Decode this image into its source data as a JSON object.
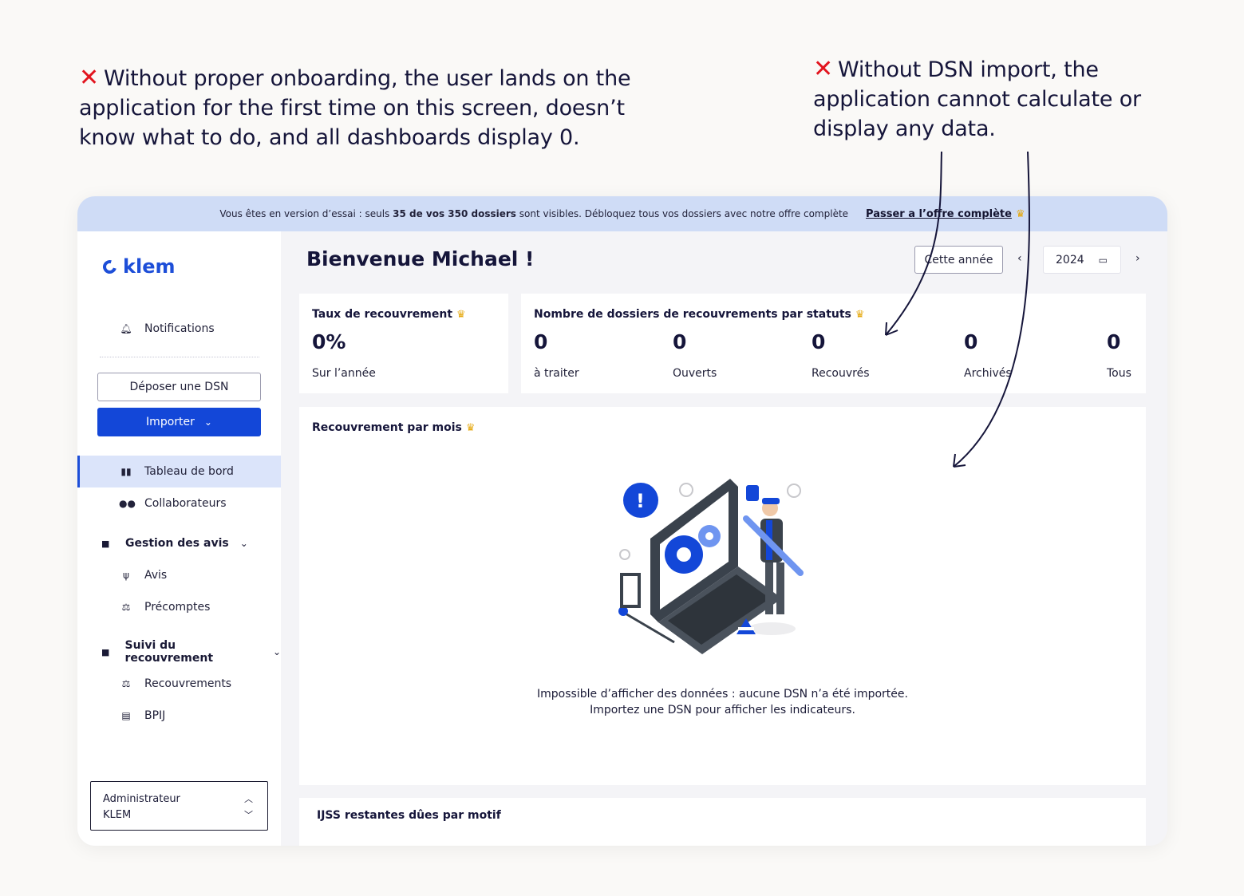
{
  "annotations": {
    "left": "Without proper onboarding, the user lands on the application for the first time on this screen, doesn’t know what to do, and all dashboards display 0.",
    "right": "Without DSN import, the application cannot calculate or display any data."
  },
  "banner": {
    "text_prefix": "Vous êtes en version d’essai : seuls ",
    "text_bold": "35 de vos 350 dossiers",
    "text_suffix": " sont visibles. Débloquez tous vos dossiers avec notre offre complète",
    "cta": "Passer a l’offre complète"
  },
  "sidebar": {
    "logo": "klem",
    "notifications": "Notifications",
    "deposit_button": "Déposer une DSN",
    "import_button": "Importer",
    "items": [
      {
        "label": "Tableau de bord",
        "icon": "bar-chart-icon"
      },
      {
        "label": "Collaborateurs",
        "icon": "users-icon"
      }
    ],
    "group_avis": {
      "label": "Gestion des avis",
      "items": [
        {
          "label": "Avis",
          "icon": "stethoscope-icon"
        },
        {
          "label": "Précomptes",
          "icon": "scale-icon"
        }
      ]
    },
    "group_suivi": {
      "label": "Suivi du recouvrement",
      "items": [
        {
          "label": "Recouvrements",
          "icon": "scale-icon"
        },
        {
          "label": "BPIJ",
          "icon": "document-icon"
        }
      ]
    },
    "role": {
      "title": "Administrateur",
      "org": "KLEM"
    }
  },
  "header": {
    "welcome": "Bienvenue Michael !",
    "period_button": "Cette année",
    "year": "2024"
  },
  "cards": {
    "taux": {
      "title": "Taux de recouvrement",
      "value": "0%",
      "caption": "Sur l’année"
    },
    "statuts": {
      "title": "Nombre de dossiers de recouvrements par statuts",
      "items": [
        {
          "value": "0",
          "label": "à traiter"
        },
        {
          "value": "0",
          "label": "Ouverts"
        },
        {
          "value": "0",
          "label": "Recouvrés"
        },
        {
          "value": "0",
          "label": "Archivés"
        },
        {
          "value": "0",
          "label": "Tous"
        }
      ]
    },
    "mois": {
      "title": "Recouvrement par mois",
      "empty_line1": "Impossible d’afficher des données : aucune DSN n’a été importée.",
      "empty_line2": "Importez une DSN pour afficher les indicateurs."
    },
    "ijss": {
      "title": "IJSS restantes dûes par motif"
    }
  },
  "colors": {
    "brand": "#1347d8",
    "banner": "#cfdcf6",
    "crown": "#e5a80e",
    "error": "#e2141e"
  }
}
